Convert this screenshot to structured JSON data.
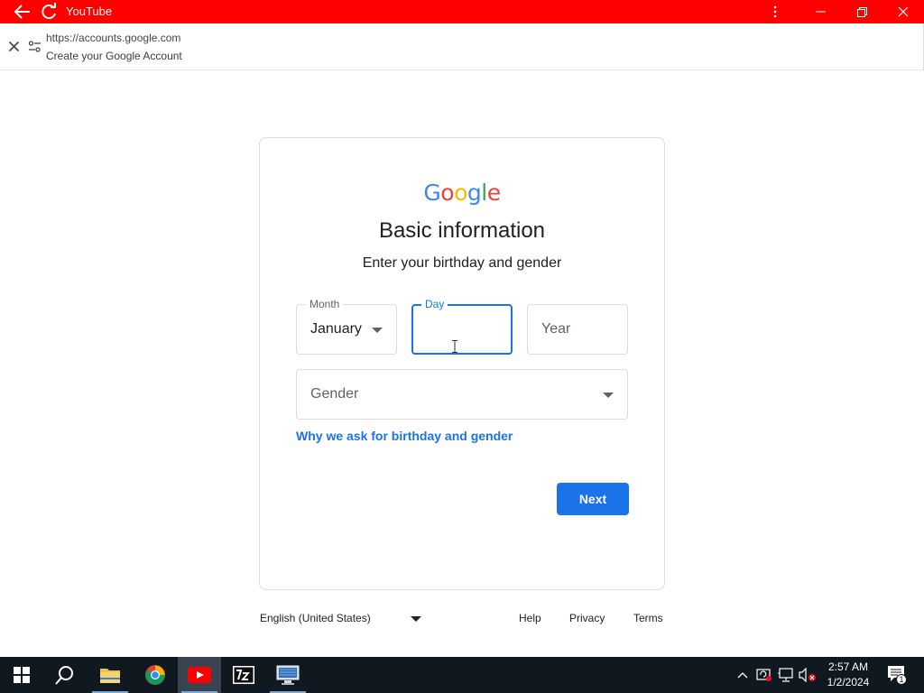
{
  "app": {
    "title": "YouTube"
  },
  "tab": {
    "url": "https://accounts.google.com",
    "page_title": "Create your Google Account"
  },
  "logo": {
    "letters": [
      {
        "ch": "G",
        "color": "#4285F4"
      },
      {
        "ch": "o",
        "color": "#EA4335"
      },
      {
        "ch": "o",
        "color": "#FBBC05"
      },
      {
        "ch": "g",
        "color": "#4285F4"
      },
      {
        "ch": "l",
        "color": "#34A853"
      },
      {
        "ch": "e",
        "color": "#EA4335"
      }
    ]
  },
  "form": {
    "heading": "Basic information",
    "subheading": "Enter your birthday and gender",
    "month": {
      "label": "Month",
      "value": "January"
    },
    "day": {
      "label": "Day",
      "value": ""
    },
    "year": {
      "placeholder": "Year"
    },
    "gender": {
      "placeholder": "Gender"
    },
    "why_link": "Why we ask for birthday and gender",
    "next_label": "Next"
  },
  "footer": {
    "language": "English (United States)",
    "help": "Help",
    "privacy": "Privacy",
    "terms": "Terms"
  },
  "taskbar": {
    "time": "2:57 AM",
    "date": "1/2/2024",
    "notification_count": "1"
  },
  "colors": {
    "titlebar": "#ff0000",
    "accent": "#1a73e8",
    "taskbar": "#101820"
  }
}
